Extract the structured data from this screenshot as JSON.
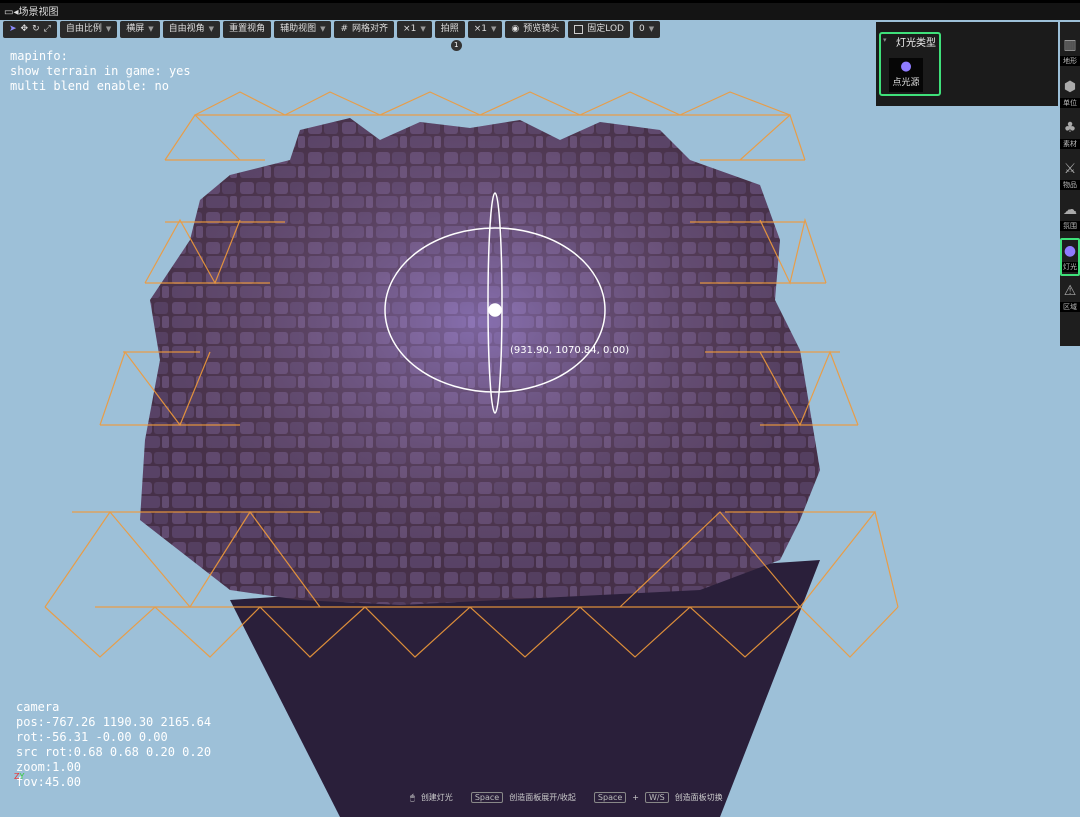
{
  "window": {
    "title": "场景视图"
  },
  "toolbar": {
    "items": [
      {
        "label": "自由比例",
        "dropdown": true
      },
      {
        "label": "横屏",
        "dropdown": true
      },
      {
        "label": "自由视角",
        "dropdown": true
      },
      {
        "label": "重置视角",
        "dropdown": false
      },
      {
        "label": "辅助视图",
        "dropdown": true
      },
      {
        "label": "网格对齐",
        "dropdown": false,
        "icon": "grid-icon"
      },
      {
        "label": "×1",
        "dropdown": true
      },
      {
        "label": "拍照",
        "dropdown": false
      },
      {
        "label": "×1",
        "dropdown": true
      },
      {
        "label": "预览镜头",
        "dropdown": false,
        "icon": "eye-icon"
      },
      {
        "label": "固定LOD",
        "dropdown": false,
        "icon": "checkbox-icon"
      },
      {
        "label": "0",
        "dropdown": true
      }
    ],
    "badge": "1"
  },
  "mapinfo": {
    "text": "mapinfo:\nshow terrain in game: yes\nmulti blend enable: no"
  },
  "camera": {
    "text": "camera\npos:-767.26 1190.30 2165.64\nrot:-56.31 -0.00 0.00\nsrc rot:0.68 0.68 0.20 0.20\nzoom:1.00\nfov:45.00"
  },
  "gizmo": {
    "coords": "(931.90, 1070.84, 0.00)"
  },
  "light_panel": {
    "title": "灯光类型",
    "item": "点光源",
    "accent": "#3fe07a"
  },
  "sidebar": {
    "items": [
      {
        "label": "地形",
        "icon": "map-icon"
      },
      {
        "label": "单位",
        "icon": "cube-icon"
      },
      {
        "label": "素材",
        "icon": "tree-icon"
      },
      {
        "label": "物品",
        "icon": "sword-icon"
      },
      {
        "label": "氛围",
        "icon": "weather-icon"
      },
      {
        "label": "灯光",
        "icon": "lightbulb-icon",
        "active": true
      },
      {
        "label": "区域",
        "icon": "warning-icon"
      }
    ]
  },
  "hints": {
    "create": "创建灯光",
    "space": "Space",
    "toggle": "创造面板展开/收起",
    "plus": "+",
    "ws": "W/S",
    "switch": "创造面板切换"
  }
}
